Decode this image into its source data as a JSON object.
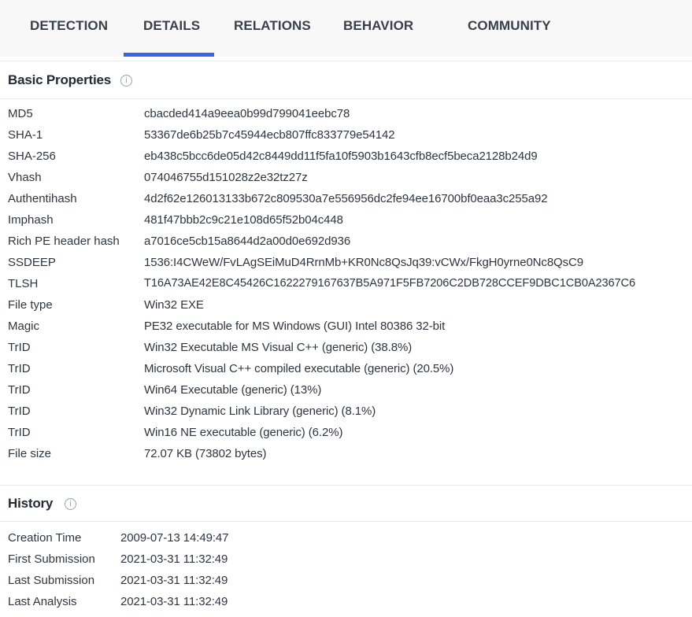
{
  "tabs": [
    {
      "label": "DETECTION"
    },
    {
      "label": "DETAILS",
      "active": true
    },
    {
      "label": "RELATIONS"
    },
    {
      "label": "BEHAVIOR"
    },
    {
      "label": "COMMUNITY"
    }
  ],
  "accent_color": "#3b61f1",
  "basic_properties": {
    "title": "Basic Properties",
    "info_icon": "info-icon",
    "rows": [
      {
        "key": "MD5",
        "value": "cbacded414a9eea0b99d799041eebc78"
      },
      {
        "key": "SHA-1",
        "value": "53367de6b25b7c45944ecb807ffc833779e54142"
      },
      {
        "key": "SHA-256",
        "value": "eb438c5bcc6de05d42c8449dd11f5fa10f5903b1643cfb8ecf5beca2128b24d9"
      },
      {
        "key": "Vhash",
        "value": "074046755d151028z2e32tz27z"
      },
      {
        "key": "Authentihash",
        "value": "4d2f62e126013133b672c809530a7e556956dc2fe94ee16700bf0eaa3c255a92"
      },
      {
        "key": "Imphash",
        "value": "481f47bbb2c9c21e108d65f52b04c448"
      },
      {
        "key": "Rich PE header hash",
        "value": "a7016ce5cb15a8644d2a00d0e692d936"
      },
      {
        "key": "SSDEEP",
        "value": "1536:I4CWeW/FvLAgSEiMuD4RrnMb+KR0Nc8QsJq39:vCWx/FkgH0yrne0Nc8QsC9"
      },
      {
        "key": "TLSH",
        "value": "T16A73AE42E8C45426C162227916763​7B5A971F5FB7206C2DB728CCEF9DBC1CB0A2367C6"
      },
      {
        "key": "File type",
        "value": "Win32 EXE"
      },
      {
        "key": "Magic",
        "value": "PE32 executable for MS Windows (GUI) Intel 80386 32-bit"
      },
      {
        "key": "TrID",
        "value": "Win32 Executable MS Visual C++ (generic) (38.8%)"
      },
      {
        "key": "TrID",
        "value": "Microsoft Visual C++ compiled executable (generic) (20.5%)"
      },
      {
        "key": "TrID",
        "value": "Win64 Executable (generic) (13%)"
      },
      {
        "key": "TrID",
        "value": "Win32 Dynamic Link Library (generic) (8.1%)"
      },
      {
        "key": "TrID",
        "value": "Win16 NE executable (generic) (6.2%)"
      },
      {
        "key": "File size",
        "value": "72.07 KB (73802 bytes)"
      }
    ]
  },
  "history": {
    "title": "History",
    "info_icon": "info-icon",
    "rows": [
      {
        "key": "Creation Time",
        "value": "2009-07-13 14:49:47"
      },
      {
        "key": "First Submission",
        "value": "2021-03-31 11:32:49"
      },
      {
        "key": "Last Submission",
        "value": "2021-03-31 11:32:49"
      },
      {
        "key": "Last Analysis",
        "value": "2021-03-31 11:32:49"
      }
    ]
  }
}
